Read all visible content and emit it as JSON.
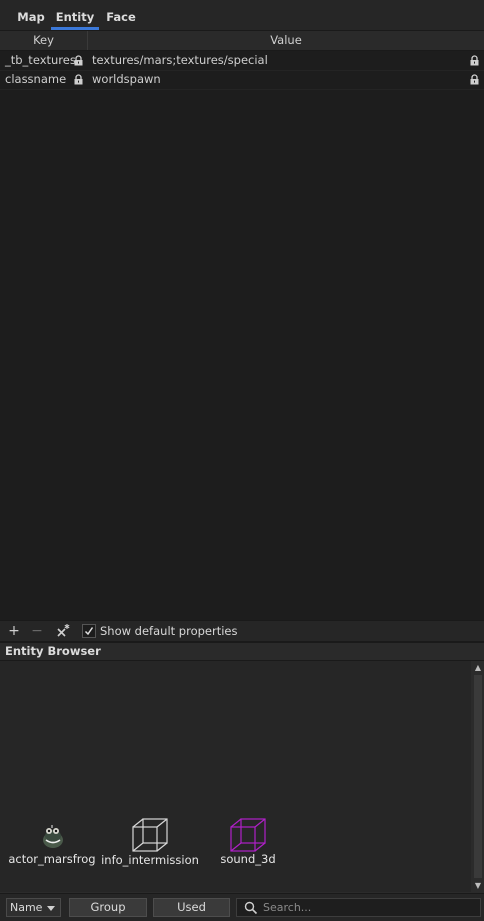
{
  "tabs": [
    {
      "label": "Map",
      "active": false
    },
    {
      "label": "Entity",
      "active": true
    },
    {
      "label": "Face",
      "active": false
    }
  ],
  "table": {
    "headers": {
      "key": "Key",
      "value": "Value"
    },
    "rows": [
      {
        "key": "_tb_textures",
        "value": "textures/mars;textures/special",
        "key_locked": true,
        "value_locked": true
      },
      {
        "key": "classname",
        "value": "worldspawn",
        "key_locked": true,
        "value_locked": true
      }
    ]
  },
  "toolbar": {
    "add_icon": "plus-icon",
    "remove_icon": "minus-icon",
    "remove_all_icon": "clear-properties-icon",
    "add_symbol": "+",
    "remove_symbol": "−",
    "show_default_checked": true,
    "show_default_label": "Show default properties"
  },
  "entity_browser": {
    "title": "Entity Browser",
    "entities": [
      {
        "name": "actor_marsfrog",
        "icon": "frog-model-icon",
        "color": "#4a5a4a"
      },
      {
        "name": "info_intermission",
        "icon": "wireframe-cube-icon",
        "color": "#d8d8d8"
      },
      {
        "name": "sound_3d",
        "icon": "wireframe-cube-icon",
        "color": "#b020c8"
      }
    ]
  },
  "bottom": {
    "sort_value": "Name",
    "group_label": "Group",
    "used_label": "Used",
    "search_placeholder": "Search..."
  },
  "colors": {
    "accent": "#3b78d8",
    "background": "#1d1d1d",
    "panel": "#262626"
  }
}
